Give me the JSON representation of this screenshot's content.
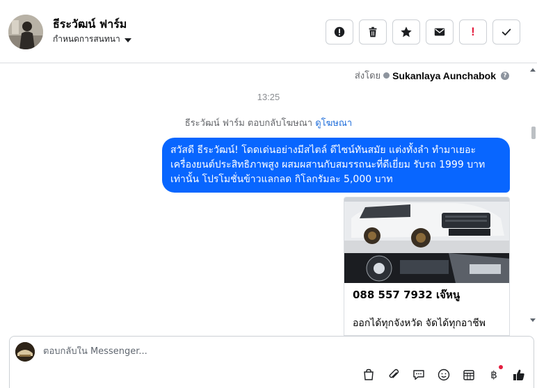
{
  "header": {
    "title": "ธีระวัฒน์ ฟาร์ม",
    "subtitle": "กำหนดการสนทนา",
    "toolbar": {
      "spam": "exclamation-circle-icon",
      "delete": "trash-icon",
      "star": "star-icon",
      "mark_unread": "envelope-icon",
      "flag": "!",
      "done": "check-icon"
    }
  },
  "chat": {
    "sent_by_label": "ส่งโดย",
    "sent_by_name": "Sukanlaya Aunchabok",
    "time": "13:25",
    "ad_reply_text": "ธีระวัฒน์ ฟาร์ม ตอบกลับโฆษณา",
    "ad_link": "ดูโฆษณา",
    "message": "สวัสดี ธีระวัฒน์! โดดเด่นอย่างมีสไตล์ ดีไซน์ทันสมัย แต่งทั้งลำ ทำมาเยอะ เครื่องยนต์ประสิทธิภาพสูง ผสมผสานกับสมรรถนะที่ดีเยี่ยม รับรถ 1999 บาทเท่านั้น โปรโมชั่นข้าวแลกลด กิโลกรัมละ 5,000 บาท",
    "ad_card": {
      "phone": "088 557 7932 เจ๊หนู",
      "description": "ออกได้ทุกจังหวัด จัดได้ทุกอาชีพ"
    }
  },
  "composer": {
    "placeholder": "ตอบกลับใน Messenger...",
    "tools": [
      "bag-icon",
      "paperclip-icon",
      "chat-bubble-icon",
      "emoji-icon",
      "calendar-icon",
      "baht-icon",
      "thumbs-up-icon"
    ],
    "baht_symbol": "฿"
  },
  "colors": {
    "accent": "#0866ff",
    "link": "#216fdb",
    "alert": "#e41e3f"
  }
}
